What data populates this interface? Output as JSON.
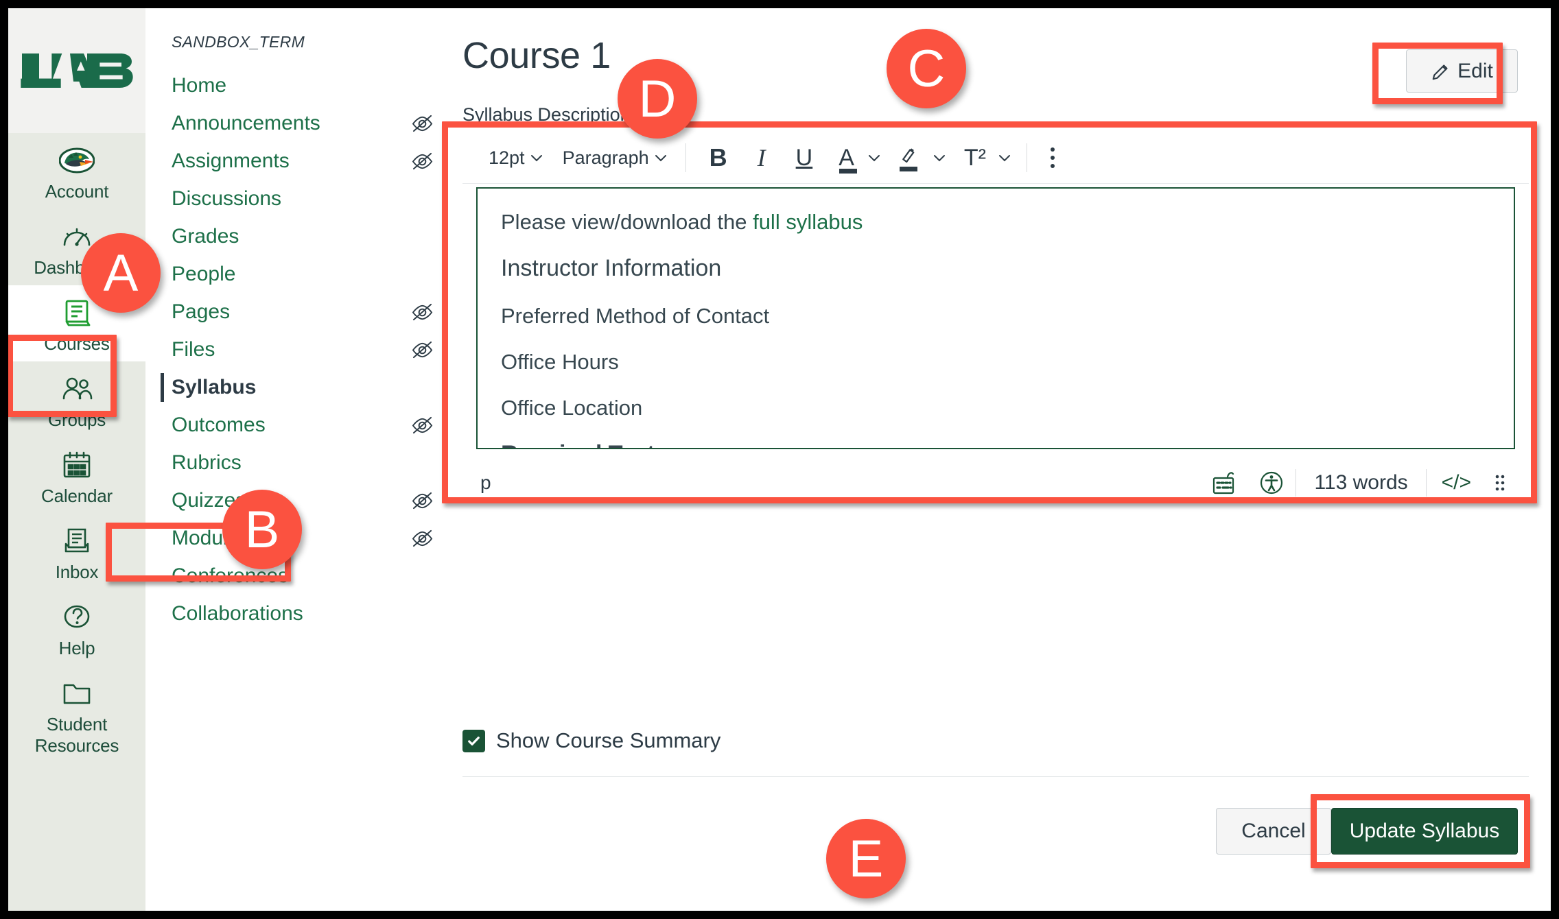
{
  "brand": {
    "logo_alt": "UAB"
  },
  "global_nav": {
    "items": [
      {
        "label": "Account",
        "icon": "dragon-mascot-icon",
        "selected": false
      },
      {
        "label": "Dashboard",
        "icon": "dashboard-gauge-icon",
        "selected": false
      },
      {
        "label": "Courses",
        "icon": "courses-book-icon",
        "selected": true
      },
      {
        "label": "Groups",
        "icon": "groups-people-icon",
        "selected": false
      },
      {
        "label": "Calendar",
        "icon": "calendar-icon",
        "selected": false
      },
      {
        "label": "Inbox",
        "icon": "inbox-tray-icon",
        "selected": false
      },
      {
        "label": "Help",
        "icon": "help-question-icon",
        "selected": false
      },
      {
        "label": "Student\nResources",
        "icon": "folder-icon",
        "selected": false
      }
    ]
  },
  "course_nav": {
    "term": "SANDBOX_TERM",
    "items": [
      {
        "label": "Home",
        "hidden_icon": false,
        "active": false
      },
      {
        "label": "Announcements",
        "hidden_icon": true,
        "active": false
      },
      {
        "label": "Assignments",
        "hidden_icon": true,
        "active": false
      },
      {
        "label": "Discussions",
        "hidden_icon": false,
        "active": false
      },
      {
        "label": "Grades",
        "hidden_icon": false,
        "active": false
      },
      {
        "label": "People",
        "hidden_icon": false,
        "active": false
      },
      {
        "label": "Pages",
        "hidden_icon": true,
        "active": false
      },
      {
        "label": "Files",
        "hidden_icon": true,
        "active": false
      },
      {
        "label": "Syllabus",
        "hidden_icon": false,
        "active": true
      },
      {
        "label": "Outcomes",
        "hidden_icon": true,
        "active": false
      },
      {
        "label": "Rubrics",
        "hidden_icon": false,
        "active": false
      },
      {
        "label": "Quizzes",
        "hidden_icon": true,
        "active": false
      },
      {
        "label": "Modules",
        "hidden_icon": true,
        "active": false
      },
      {
        "label": "Conferences",
        "hidden_icon": false,
        "active": false
      },
      {
        "label": "Collaborations",
        "hidden_icon": false,
        "active": false
      }
    ]
  },
  "main": {
    "page_title": "Course 1",
    "syllabus_description_label": "Syllabus Description:",
    "edit_button": {
      "label": "Edit",
      "icon": "pencil-icon"
    }
  },
  "editor": {
    "toolbar": {
      "font_size": "12pt",
      "block_format": "Paragraph",
      "bold": "B",
      "italic": "I",
      "underline": "U",
      "text_color": "A",
      "highlight": "highlighter-icon",
      "superscript": "T²",
      "more_options": "kebab-menu-icon"
    },
    "content": {
      "intro_prefix": "Please view/download the ",
      "intro_link": "full syllabus",
      "heading": "Instructor Information",
      "lines": [
        "Preferred Method of Contact",
        "Office Hours",
        "Office Location"
      ],
      "clipped_line": "Required Text"
    },
    "status_bar": {
      "element_path": "p",
      "word_count": "113 words",
      "keyboard_icon": "keyboard-shortcuts-icon",
      "a11y_icon": "accessibility-checker-icon",
      "html_editor_icon": "</>",
      "resize_handle": "resize-grip-icon"
    }
  },
  "course_summary": {
    "label": "Show Course Summary",
    "checked": true
  },
  "footer": {
    "cancel_label": "Cancel",
    "update_label": "Update Syllabus"
  },
  "callouts": [
    {
      "letter": "A",
      "target": "courses-global-nav-item"
    },
    {
      "letter": "B",
      "target": "syllabus-course-nav-item"
    },
    {
      "letter": "C",
      "target": "edit-button"
    },
    {
      "letter": "D",
      "target": "rich-content-editor"
    },
    {
      "letter": "E",
      "target": "update-syllabus-button"
    }
  ],
  "colors": {
    "brand_green": "#1a5336",
    "link_green": "#1d7049",
    "callout_red": "#fb5240",
    "text_dark": "#2d3b45",
    "nav_bg": "#e7eae3"
  }
}
